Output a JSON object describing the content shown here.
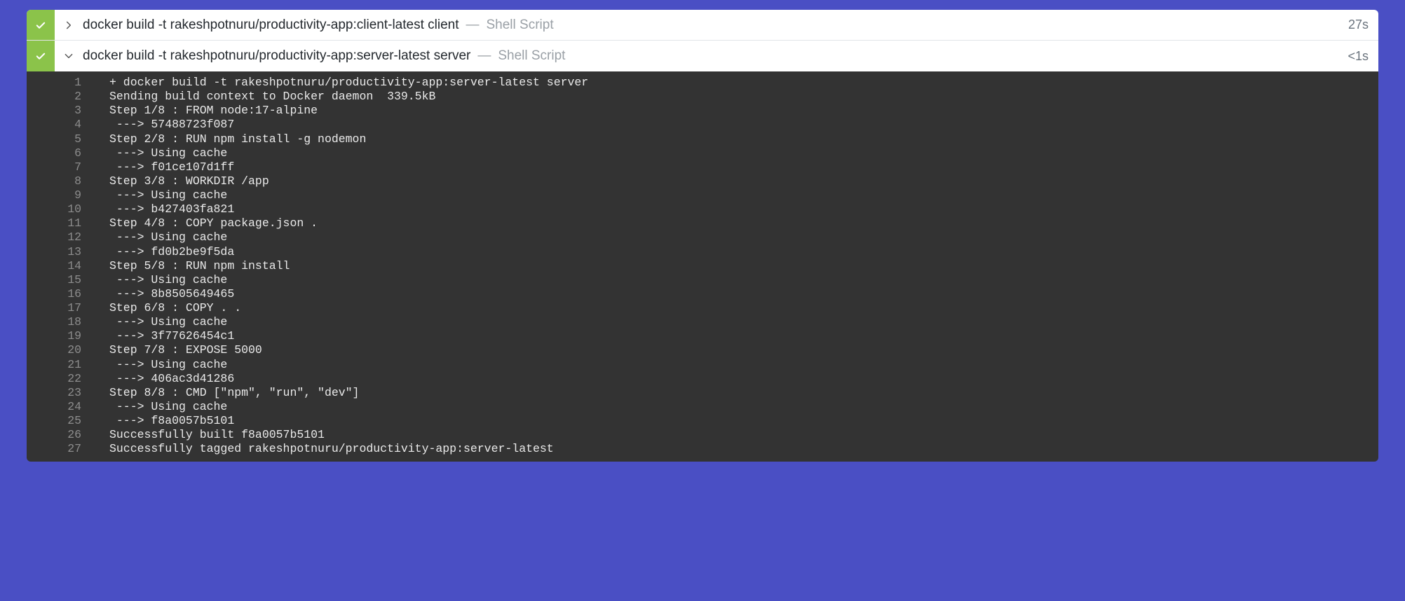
{
  "steps": [
    {
      "status": "success",
      "expanded": false,
      "command": "docker build -t rakeshpotnuru/productivity-app:client-latest client",
      "dash": "—",
      "kind": "Shell Script",
      "duration": "27s"
    },
    {
      "status": "success",
      "expanded": true,
      "command": "docker build -t rakeshpotnuru/productivity-app:server-latest server",
      "dash": "—",
      "kind": "Shell Script",
      "duration": "<1s"
    }
  ],
  "console": [
    "+ docker build -t rakeshpotnuru/productivity-app:server-latest server",
    "Sending build context to Docker daemon  339.5kB",
    "Step 1/8 : FROM node:17-alpine",
    " ---> 57488723f087",
    "Step 2/8 : RUN npm install -g nodemon",
    " ---> Using cache",
    " ---> f01ce107d1ff",
    "Step 3/8 : WORKDIR /app",
    " ---> Using cache",
    " ---> b427403fa821",
    "Step 4/8 : COPY package.json .",
    " ---> Using cache",
    " ---> fd0b2be9f5da",
    "Step 5/8 : RUN npm install",
    " ---> Using cache",
    " ---> 8b8505649465",
    "Step 6/8 : COPY . .",
    " ---> Using cache",
    " ---> 3f77626454c1",
    "Step 7/8 : EXPOSE 5000",
    " ---> Using cache",
    " ---> 406ac3d41286",
    "Step 8/8 : CMD [\"npm\", \"run\", \"dev\"]",
    " ---> Using cache",
    " ---> f8a0057b5101",
    "Successfully built f8a0057b5101",
    "Successfully tagged rakeshpotnuru/productivity-app:server-latest"
  ]
}
